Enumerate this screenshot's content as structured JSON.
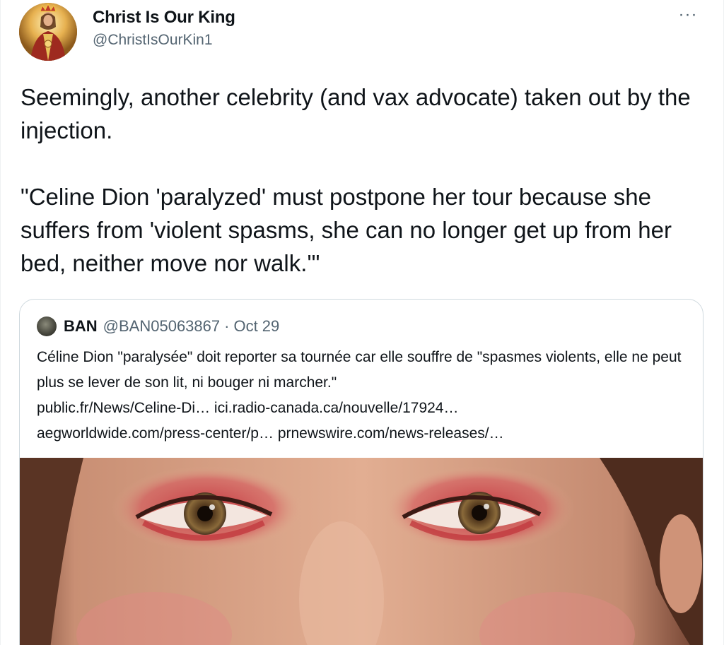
{
  "author": {
    "display_name": "Christ Is Our King",
    "handle": "@ChristIsOurKin1",
    "avatar_icon": "avatar-image"
  },
  "more_icon": "···",
  "tweet": {
    "paragraph1": "Seemingly, another celebrity (and vax advocate) taken out by the injection.",
    "paragraph2": "\"Celine Dion 'paralyzed' must postpone her tour because she suffers from 'violent spasms, she can no longer get up from her bed, neither move nor walk.'\""
  },
  "quoted": {
    "name": "BAN",
    "handle": "@BAN05063867",
    "separator": "·",
    "date": "Oct 29",
    "text_line1": "Céline Dion \"paralysée\" doit reporter sa tournée car elle souffre de \"spasmes violents, elle ne peut plus se lever de son lit, ni bouger ni marcher.\"",
    "links": [
      "public.fr/News/Celine-Di…",
      "ici.radio-canada.ca/nouvelle/17924…",
      "aegworldwide.com/press-center/p…",
      "prnewswire.com/news-releases/…"
    ],
    "media": "close-up photo of eyes with red eye makeup"
  },
  "colors": {
    "text": "#0f1419",
    "secondary": "#536471",
    "border": "#cfd9de"
  }
}
